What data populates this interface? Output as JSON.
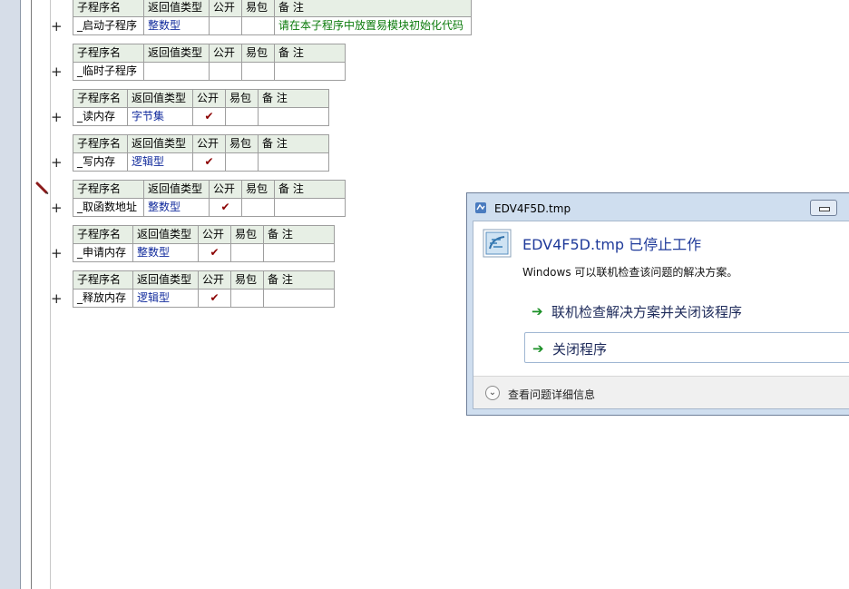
{
  "headers": [
    "子程序名",
    "返回值类型",
    "公开",
    "易包",
    "备 注"
  ],
  "subprograms": [
    {
      "name": "_启动子程序",
      "return_type": "整数型",
      "public": "",
      "easy_pack": "",
      "comment": "请在本子程序中放置易模块初始化代码"
    },
    {
      "name": "_临时子程序",
      "return_type": "",
      "public": "",
      "easy_pack": "",
      "comment": ""
    },
    {
      "name": "_读内存",
      "return_type": "字节集",
      "public": "✔",
      "easy_pack": "",
      "comment": ""
    },
    {
      "name": "_写内存",
      "return_type": "逻辑型",
      "public": "✔",
      "easy_pack": "",
      "comment": ""
    },
    {
      "name": "_取函数地址",
      "return_type": "整数型",
      "public": "✔",
      "easy_pack": "",
      "comment": ""
    },
    {
      "name": "_申请内存",
      "return_type": "整数型",
      "public": "✔",
      "easy_pack": "",
      "comment": ""
    },
    {
      "name": "_释放内存",
      "return_type": "逻辑型",
      "public": "✔",
      "easy_pack": "",
      "comment": ""
    }
  ],
  "expand_symbol": "+",
  "dialog": {
    "title": "EDV4F5D.tmp",
    "heading": "EDV4F5D.tmp 已停止工作",
    "description": "Windows 可以联机检查该问题的解决方案。",
    "option1": "联机检查解决方案并关闭该程序",
    "option2": "关闭程序",
    "details": "查看问题详细信息",
    "option_arrow": "➔",
    "details_chevron": "⌄"
  },
  "colors": {
    "header_bg": "#e7efe5",
    "type_text": "#102a9c",
    "comment_text": "#0a7a0a",
    "check": "#8b0000",
    "dialog_frame": "#cfdeef",
    "heading_text": "#1f3a9a"
  }
}
